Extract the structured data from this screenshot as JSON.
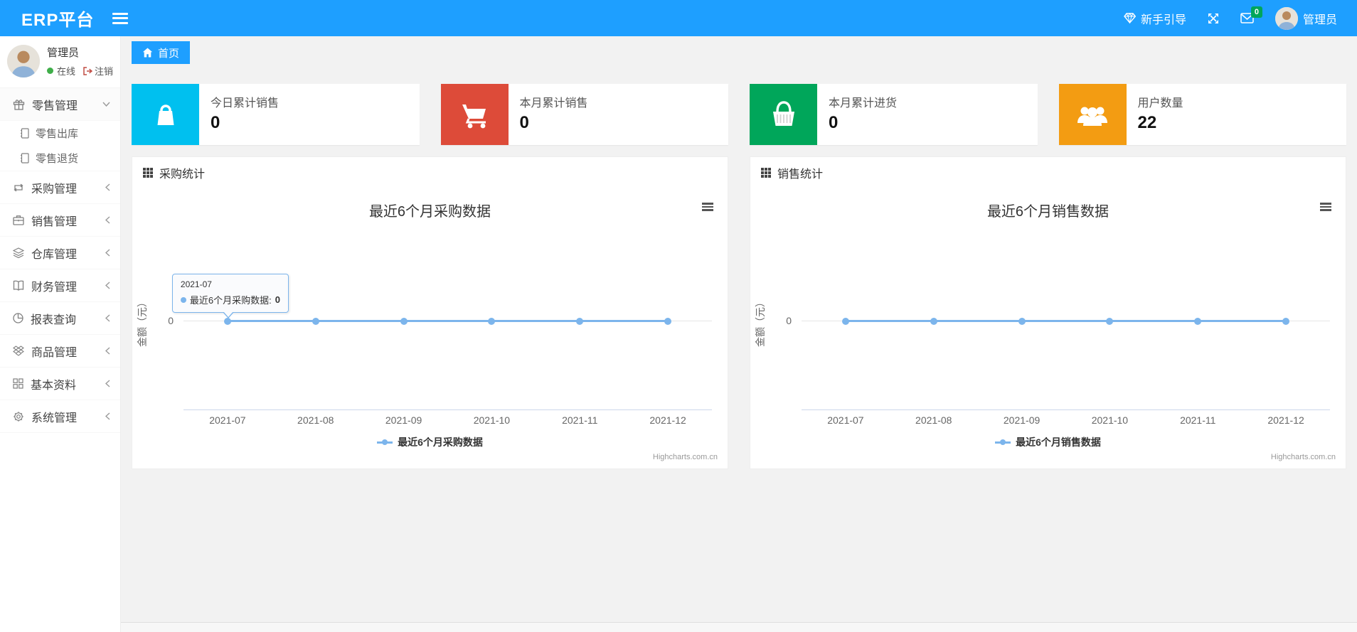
{
  "navbar": {
    "brand": "ERP平台",
    "guide_label": "新手引导",
    "mail_badge": "0",
    "username": "管理员"
  },
  "sidebar": {
    "user": {
      "name": "管理员",
      "status": "在线",
      "logout": "注销"
    },
    "menu": [
      {
        "label": "零售管理",
        "icon": "gift-icon",
        "expanded": true,
        "children": [
          {
            "label": "零售出库"
          },
          {
            "label": "零售退货"
          }
        ]
      },
      {
        "label": "采购管理",
        "icon": "sync-icon"
      },
      {
        "label": "销售管理",
        "icon": "briefcase-icon"
      },
      {
        "label": "仓库管理",
        "icon": "layers-icon"
      },
      {
        "label": "财务管理",
        "icon": "book-icon"
      },
      {
        "label": "报表查询",
        "icon": "pie-chart-icon"
      },
      {
        "label": "商品管理",
        "icon": "cube-icon"
      },
      {
        "label": "基本资料",
        "icon": "grid-icon"
      },
      {
        "label": "系统管理",
        "icon": "gear-icon"
      }
    ]
  },
  "tabs": {
    "home": "首页"
  },
  "stat_cards": [
    {
      "label": "今日累计销售",
      "value": "0",
      "icon": "bag-icon",
      "color": "#00c0ef"
    },
    {
      "label": "本月累计销售",
      "value": "0",
      "icon": "cart-icon",
      "color": "#dd4b39"
    },
    {
      "label": "本月累计进货",
      "value": "0",
      "icon": "basket-icon",
      "color": "#00a65a"
    },
    {
      "label": "用户数量",
      "value": "22",
      "icon": "users-icon",
      "color": "#f39c12"
    }
  ],
  "chart_data": [
    {
      "type": "line",
      "panel_title": "采购统计",
      "title": "最近6个月采购数据",
      "categories": [
        "2021-07",
        "2021-08",
        "2021-09",
        "2021-10",
        "2021-11",
        "2021-12"
      ],
      "series": [
        {
          "name": "最近6个月采购数据",
          "values": [
            0,
            0,
            0,
            0,
            0,
            0
          ],
          "color": "#7cb5ec"
        }
      ],
      "xlabel": "",
      "ylabel": "金额（元）",
      "ytick": "0",
      "ylim": [
        0,
        0
      ],
      "grid": true,
      "legend_position": "bottom",
      "credit": "Highcharts.com.cn",
      "tooltip": {
        "header": "2021-07",
        "series_label": "最近6个月采购数据:",
        "value": "0"
      }
    },
    {
      "type": "line",
      "panel_title": "销售统计",
      "title": "最近6个月销售数据",
      "categories": [
        "2021-07",
        "2021-08",
        "2021-09",
        "2021-10",
        "2021-11",
        "2021-12"
      ],
      "series": [
        {
          "name": "最近6个月销售数据",
          "values": [
            0,
            0,
            0,
            0,
            0,
            0
          ],
          "color": "#7cb5ec"
        }
      ],
      "xlabel": "",
      "ylabel": "金额（元）",
      "ytick": "0",
      "ylim": [
        0,
        0
      ],
      "grid": true,
      "legend_position": "bottom",
      "credit": "Highcharts.com.cn"
    }
  ],
  "colors": {
    "navbar": "#1E9FFF",
    "series": "#7cb5ec",
    "online": "#3fae49",
    "badge": "#00A65A"
  }
}
